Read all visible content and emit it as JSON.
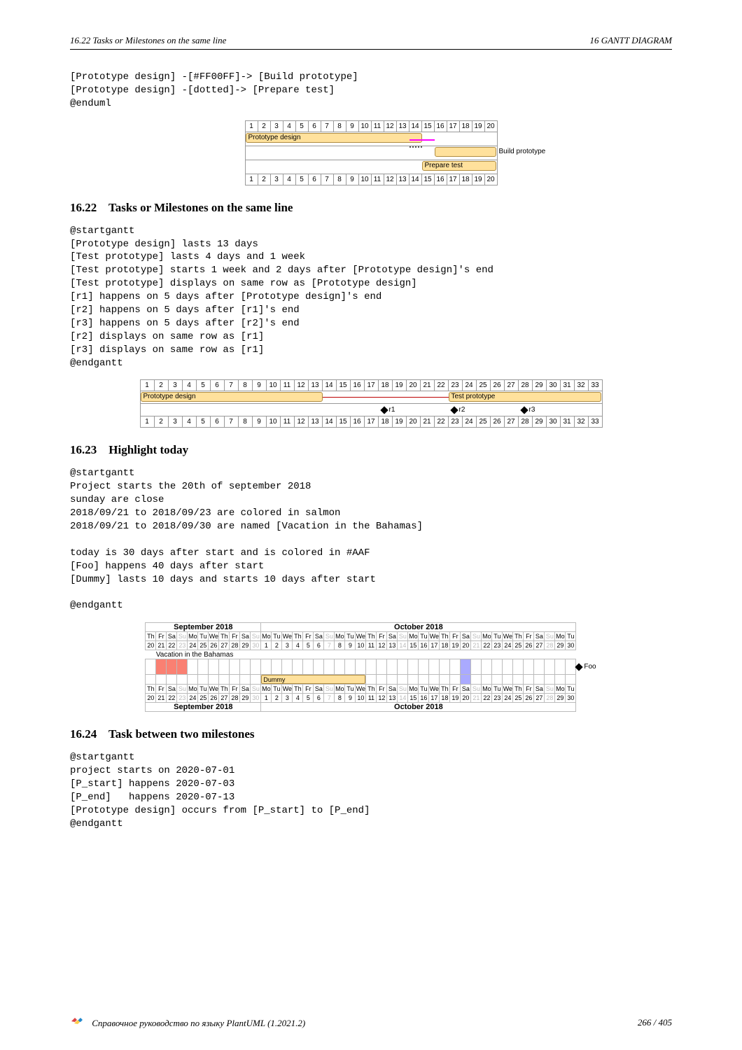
{
  "header": {
    "left": "16.22    Tasks or Milestones on the same line",
    "right": "16    GANTT DIAGRAM"
  },
  "code_intro": "[Prototype design] -[#FF00FF]-> [Build prototype]\n[Prototype design] -[dotted]-> [Prepare test]\n@enduml",
  "gantt1": {
    "days": [
      1,
      2,
      3,
      4,
      5,
      6,
      7,
      8,
      9,
      10,
      11,
      12,
      13,
      14,
      15,
      16,
      17,
      18,
      19,
      20
    ],
    "task1": "Prototype design",
    "task2": "Build prototype",
    "task3": "Prepare test"
  },
  "sec22": {
    "num": "16.22",
    "title": "Tasks or Milestones on the same line",
    "code": "@startgantt\n[Prototype design] lasts 13 days\n[Test prototype] lasts 4 days and 1 week\n[Test prototype] starts 1 week and 2 days after [Prototype design]'s end\n[Test prototype] displays on same row as [Prototype design]\n[r1] happens on 5 days after [Prototype design]'s end\n[r2] happens on 5 days after [r1]'s end\n[r3] happens on 5 days after [r2]'s end\n[r2] displays on same row as [r1]\n[r3] displays on same row as [r1]\n@endgantt"
  },
  "gantt2": {
    "days": [
      1,
      2,
      3,
      4,
      5,
      6,
      7,
      8,
      9,
      10,
      11,
      12,
      13,
      14,
      15,
      16,
      17,
      18,
      19,
      20,
      21,
      22,
      23,
      24,
      25,
      26,
      27,
      28,
      29,
      30,
      31,
      32,
      33
    ],
    "proto": "Prototype design",
    "test": "Test prototype",
    "r1": "r1",
    "r2": "r2",
    "r3": "r3"
  },
  "sec23": {
    "num": "16.23",
    "title": "Highlight today",
    "code": "@startgantt\nProject starts the 20th of september 2018\nsunday are close\n2018/09/21 to 2018/09/23 are colored in salmon\n2018/09/21 to 2018/09/30 are named [Vacation in the Bahamas]\n\ntoday is 30 days after start and is colored in #AAF\n[Foo] happens 40 days after start\n[Dummy] lasts 10 days and starts 10 days after start\n\n@endgantt"
  },
  "cal": {
    "month1": "September 2018",
    "month2": "October 2018",
    "dows": [
      "Th",
      "Fr",
      "Sa",
      "Su",
      "Mo",
      "Tu",
      "We",
      "Th",
      "Fr",
      "Sa",
      "Su",
      "Mo",
      "Tu",
      "We",
      "Th",
      "Fr",
      "Sa",
      "Su",
      "Mo",
      "Tu",
      "We",
      "Th",
      "Fr",
      "Sa",
      "Su",
      "Mo",
      "Tu",
      "We",
      "Th",
      "Fr",
      "Sa",
      "Su",
      "Mo",
      "Tu",
      "We",
      "Th",
      "Fr",
      "Sa",
      "Su",
      "Mo",
      "Tu"
    ],
    "sep_days": [
      20,
      21,
      22,
      23,
      24,
      25,
      26,
      27,
      28,
      29,
      30
    ],
    "oct_days": [
      1,
      2,
      3,
      4,
      5,
      6,
      7,
      8,
      9,
      10,
      11,
      12,
      13,
      14,
      15,
      16,
      17,
      18,
      19,
      20,
      21,
      22,
      23,
      24,
      25,
      26,
      27,
      28,
      29,
      30
    ],
    "vacation": "Vacation in the Bahamas",
    "dummy": "Dummy",
    "foo": "Foo"
  },
  "sec24": {
    "num": "16.24",
    "title": "Task between two milestones",
    "code": "@startgantt\nproject starts on 2020-07-01\n[P_start] happens 2020-07-03\n[P_end]   happens 2020-07-13\n[Prototype design] occurs from [P_start] to [P_end]\n@endgantt"
  },
  "footer": {
    "text": "Справочное руководство по языку PlantUML (1.2021.2)",
    "page": "266 / 405"
  }
}
